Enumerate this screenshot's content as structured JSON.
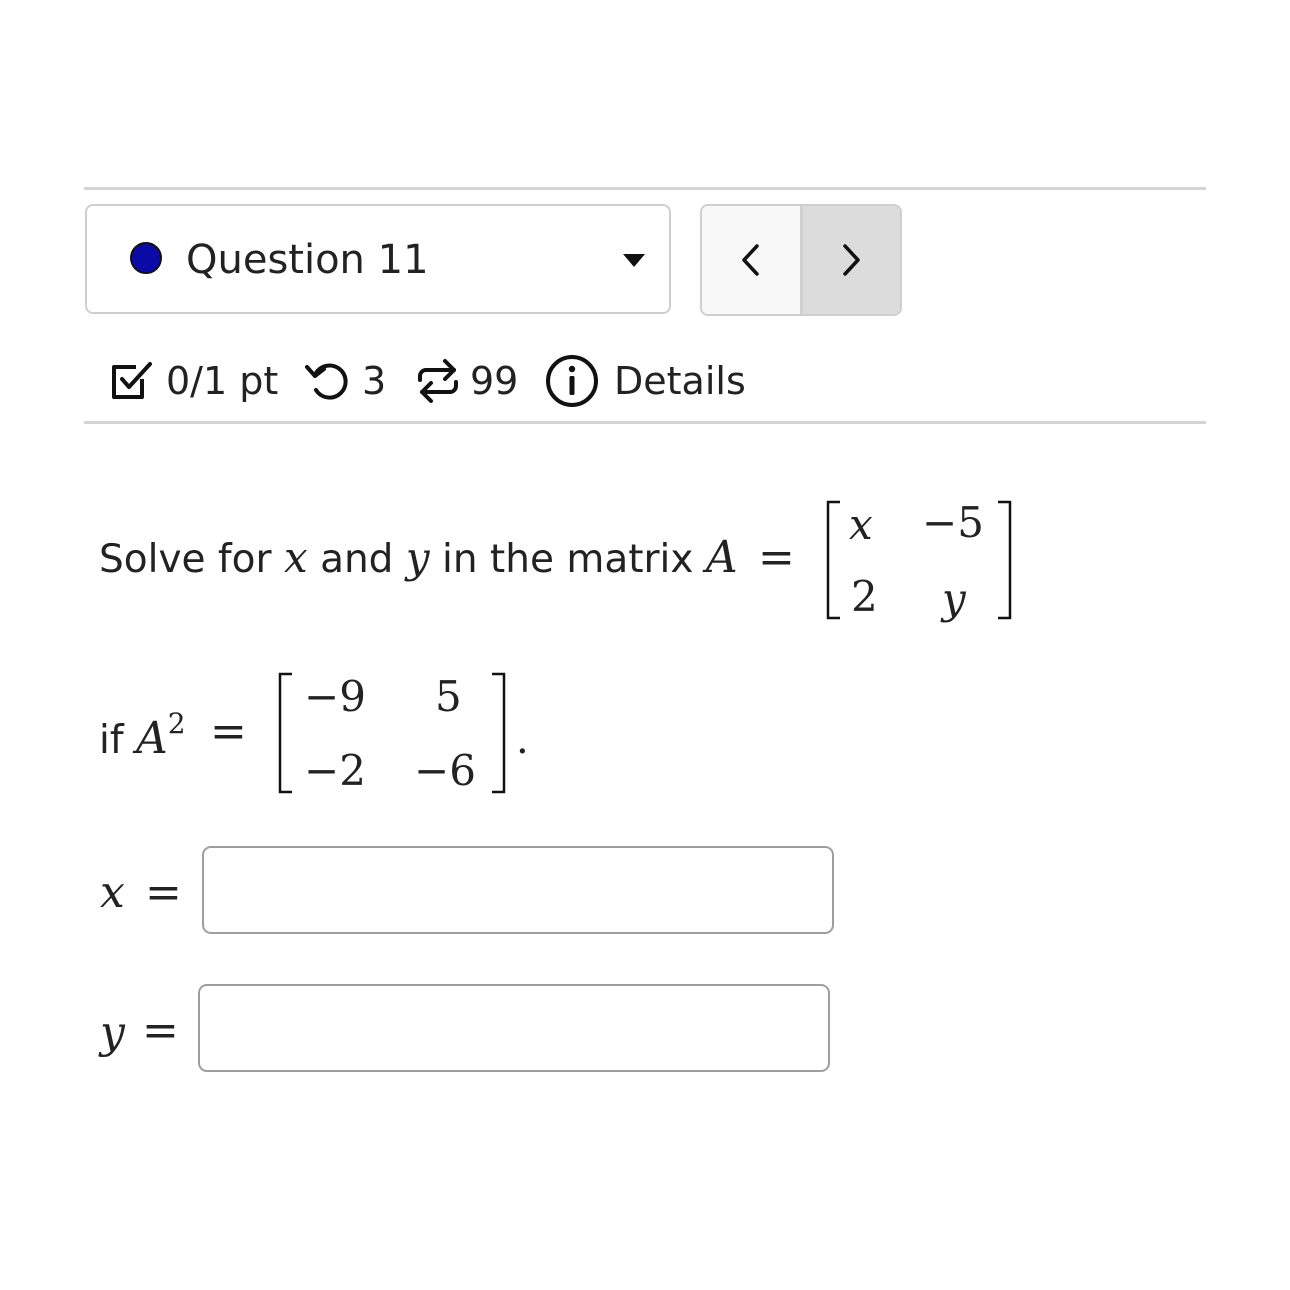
{
  "header": {
    "question_label": "Question 11",
    "status_color": "#0a0aa8"
  },
  "nav": {
    "prev_icon": "chevron-left-icon",
    "next_icon": "chevron-right-icon"
  },
  "meta": {
    "score": "0/1 pt",
    "retries": "3",
    "attempts": "99",
    "details_label": "Details"
  },
  "problem": {
    "text_solve": "Solve for",
    "var_x": "x",
    "text_and": "and",
    "var_y": "y",
    "text_in_matrix": "in the matrix",
    "matrix_name": "A",
    "equals": "=",
    "matrix_a": [
      [
        "x",
        "−5"
      ],
      [
        "2",
        "y"
      ]
    ],
    "text_if": "if",
    "a_squared_base": "A",
    "a_squared_exp": "2",
    "matrix_a_squared": [
      [
        "−9",
        "5"
      ],
      [
        "−2",
        "−6"
      ]
    ],
    "period": "."
  },
  "answers": [
    {
      "label": "x",
      "equals": "=",
      "value": "",
      "placeholder": ""
    },
    {
      "label": "y",
      "equals": "=",
      "value": "",
      "placeholder": ""
    }
  ]
}
